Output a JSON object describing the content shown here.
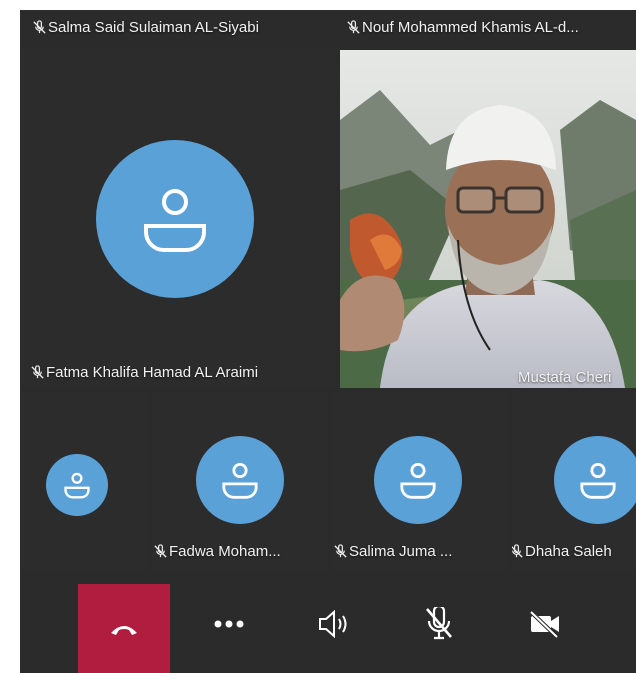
{
  "tiles": {
    "top_left_name": "Salma Said Sulaiman AL-Siyabi",
    "top_right_name": "Nouf Mohammed Khamis AL-d...",
    "main_left_name": "Fatma Khalifa Hamad AL Araimi",
    "video_name": "Mustafa Cheri",
    "row2": [
      {
        "name": ""
      },
      {
        "name": "Fadwa Moham..."
      },
      {
        "name": "Salima Juma ..."
      },
      {
        "name": "Dhaha Saleh"
      }
    ]
  },
  "icons": {
    "muted_mic": "mic-off-icon",
    "avatar": "person-icon",
    "hangup": "phone-hangup-icon",
    "more": "more-horizontal-icon",
    "speaker": "speaker-icon",
    "mic": "mic-off-icon",
    "camera": "video-off-icon"
  },
  "colors": {
    "background": "#2b2b2b",
    "avatar": "#5aa1d8",
    "hangup": "#b01d3e",
    "text": "#f2f2f2"
  }
}
